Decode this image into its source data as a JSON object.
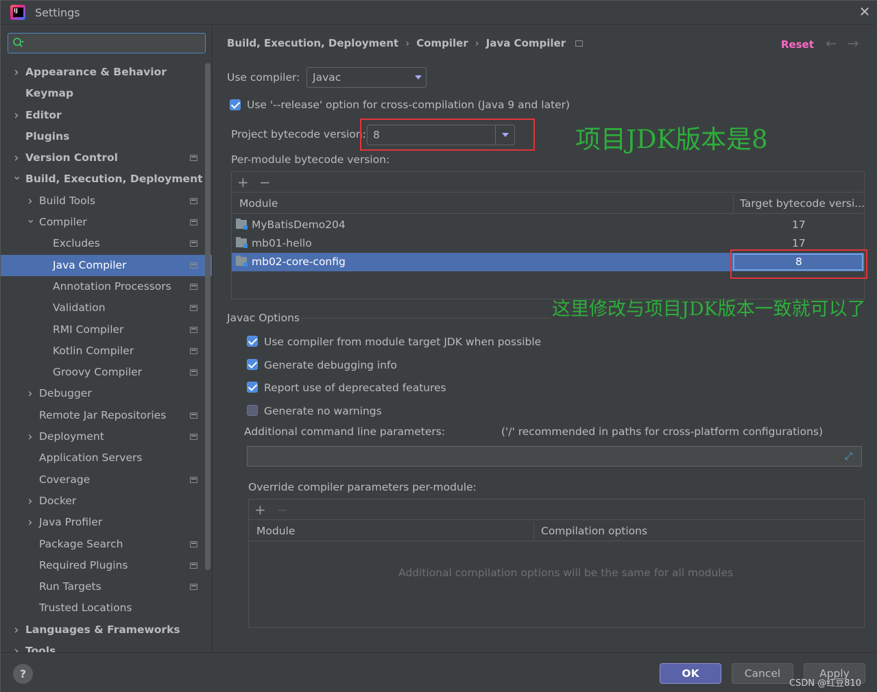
{
  "window": {
    "title": "Settings"
  },
  "search": {
    "value": "",
    "placeholder": ""
  },
  "sidebar": {
    "items": [
      {
        "label": "Appearance & Behavior",
        "bold": true,
        "level": 0,
        "chevron": "right",
        "page_icon": false
      },
      {
        "label": "Keymap",
        "bold": true,
        "level": 0,
        "chevron": "",
        "page_icon": false
      },
      {
        "label": "Editor",
        "bold": true,
        "level": 0,
        "chevron": "right",
        "page_icon": false
      },
      {
        "label": "Plugins",
        "bold": true,
        "level": 0,
        "chevron": "",
        "page_icon": false
      },
      {
        "label": "Version Control",
        "bold": true,
        "level": 0,
        "chevron": "right",
        "page_icon": true
      },
      {
        "label": "Build, Execution, Deployment",
        "bold": true,
        "level": 0,
        "chevron": "down",
        "page_icon": false
      },
      {
        "label": "Build Tools",
        "bold": false,
        "level": 1,
        "chevron": "right",
        "page_icon": true
      },
      {
        "label": "Compiler",
        "bold": false,
        "level": 1,
        "chevron": "down",
        "page_icon": true
      },
      {
        "label": "Excludes",
        "bold": false,
        "level": 2,
        "chevron": "",
        "page_icon": true
      },
      {
        "label": "Java Compiler",
        "bold": false,
        "level": 2,
        "chevron": "",
        "page_icon": true,
        "selected": true
      },
      {
        "label": "Annotation Processors",
        "bold": false,
        "level": 2,
        "chevron": "",
        "page_icon": true
      },
      {
        "label": "Validation",
        "bold": false,
        "level": 2,
        "chevron": "",
        "page_icon": true
      },
      {
        "label": "RMI Compiler",
        "bold": false,
        "level": 2,
        "chevron": "",
        "page_icon": true
      },
      {
        "label": "Kotlin Compiler",
        "bold": false,
        "level": 2,
        "chevron": "",
        "page_icon": true
      },
      {
        "label": "Groovy Compiler",
        "bold": false,
        "level": 2,
        "chevron": "",
        "page_icon": true
      },
      {
        "label": "Debugger",
        "bold": false,
        "level": 1,
        "chevron": "right",
        "page_icon": false
      },
      {
        "label": "Remote Jar Repositories",
        "bold": false,
        "level": 1,
        "chevron": "",
        "page_icon": true
      },
      {
        "label": "Deployment",
        "bold": false,
        "level": 1,
        "chevron": "right",
        "page_icon": true
      },
      {
        "label": "Application Servers",
        "bold": false,
        "level": 1,
        "chevron": "",
        "page_icon": false
      },
      {
        "label": "Coverage",
        "bold": false,
        "level": 1,
        "chevron": "",
        "page_icon": true
      },
      {
        "label": "Docker",
        "bold": false,
        "level": 1,
        "chevron": "right",
        "page_icon": false
      },
      {
        "label": "Java Profiler",
        "bold": false,
        "level": 1,
        "chevron": "right",
        "page_icon": false
      },
      {
        "label": "Package Search",
        "bold": false,
        "level": 1,
        "chevron": "",
        "page_icon": true
      },
      {
        "label": "Required Plugins",
        "bold": false,
        "level": 1,
        "chevron": "",
        "page_icon": true
      },
      {
        "label": "Run Targets",
        "bold": false,
        "level": 1,
        "chevron": "",
        "page_icon": true
      },
      {
        "label": "Trusted Locations",
        "bold": false,
        "level": 1,
        "chevron": "",
        "page_icon": false
      },
      {
        "label": "Languages & Frameworks",
        "bold": true,
        "level": 0,
        "chevron": "right",
        "page_icon": false
      },
      {
        "label": "Tools",
        "bold": true,
        "level": 0,
        "chevron": "right",
        "page_icon": false
      }
    ]
  },
  "breadcrumb": {
    "items": [
      "Build, Execution, Deployment",
      "Compiler",
      "Java Compiler"
    ],
    "separator": "›"
  },
  "header": {
    "reset_label": "Reset",
    "back_icon": "←",
    "forward_icon": "→"
  },
  "compiler": {
    "use_compiler_label": "Use compiler:",
    "use_compiler_value": "Javac",
    "release_option_label": "Use '--release' option for cross-compilation (Java 9 and later)",
    "release_option_checked": true,
    "project_bytecode_label": "Project bytecode version:",
    "project_bytecode_value": "8",
    "per_module_label": "Per-module bytecode version:"
  },
  "module_table": {
    "add_icon": "+",
    "remove_icon": "−",
    "columns": [
      "Module",
      "Target bytecode versi..."
    ],
    "rows": [
      {
        "module": "MyBatisDemo204",
        "target": "17"
      },
      {
        "module": "mb01-hello",
        "target": "17"
      },
      {
        "module": "mb02-core-config",
        "target": "8",
        "selected": true
      }
    ]
  },
  "annotations": {
    "project_jdk": "项目JDK版本是8",
    "module_hint": "这里修改与项目JDK版本一致就可以了"
  },
  "javac_options": {
    "title": "Javac Options",
    "options": [
      {
        "label": "Use compiler from module target JDK when possible",
        "checked": true
      },
      {
        "label": "Generate debugging info",
        "checked": true
      },
      {
        "label": "Report use of deprecated features",
        "checked": true
      },
      {
        "label": "Generate no warnings",
        "checked": false
      }
    ],
    "additional_params_label": "Additional command line parameters:",
    "additional_params_hint": "('/' recommended in paths for cross-platform configurations)",
    "additional_params_value": "",
    "override_label": "Override compiler parameters per-module:",
    "override_columns": [
      "Module",
      "Compilation options"
    ],
    "override_empty": "Additional compilation options will be the same for all modules"
  },
  "footer": {
    "help_label": "?",
    "ok_label": "OK",
    "cancel_label": "Cancel",
    "apply_label": "Apply",
    "watermark": "CSDN @红豆810"
  },
  "colors": {
    "accent": "#4b6eaf",
    "reset": "#ff69c6",
    "annotation": "#2dae3c",
    "highlight_box": "#e3343a"
  }
}
